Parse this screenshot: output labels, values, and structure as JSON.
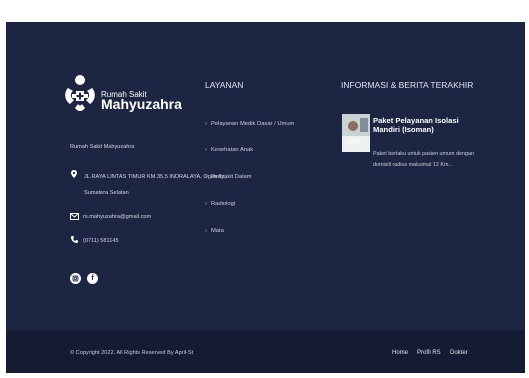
{
  "brand": {
    "line1": "Rumah Sakit",
    "line2": "Mahyuzahra"
  },
  "contact": {
    "name": "Rumah Sakit Mahyuzahra",
    "address_line1": "JL.RAYA LINTAS TIMUR KM.35,5 INDRALAYA, Ogan Ilir,",
    "address_line2": "Sumatera Selatan",
    "email": "rs.mahyuzahra@gmail.com",
    "phone": "(0711) 581145",
    "location_icon": "map-pin-icon",
    "email_icon": "envelope-icon",
    "phone_icon": "phone-icon"
  },
  "social": {
    "instagram_icon": "instagram-icon",
    "facebook_glyph": "f"
  },
  "services": {
    "title": "LAYANAN",
    "arrow": "›",
    "items": [
      "Pelayanan Medik Dasar / Umum",
      "Kesehatan Anak",
      "Penyakit Dalam",
      "Radiologi",
      "Mata"
    ]
  },
  "news": {
    "title": "INFORMASI & BERITA TERAKHIR",
    "post_title": "Paket Pelayanan Isolasi Mandiri (Isoman)",
    "post_excerpt": "Paket berlaku untuk pasien umum dengan domisili radius maksimal 12 Km..."
  },
  "bottom": {
    "copyright": "© Copyright 2022. All Rights Reserved By April-St",
    "nav": [
      "Home",
      "Profil RS",
      "Dokter"
    ]
  },
  "colors": {
    "footer_bg": "#1c2541",
    "bottom_bg": "#141c33"
  }
}
